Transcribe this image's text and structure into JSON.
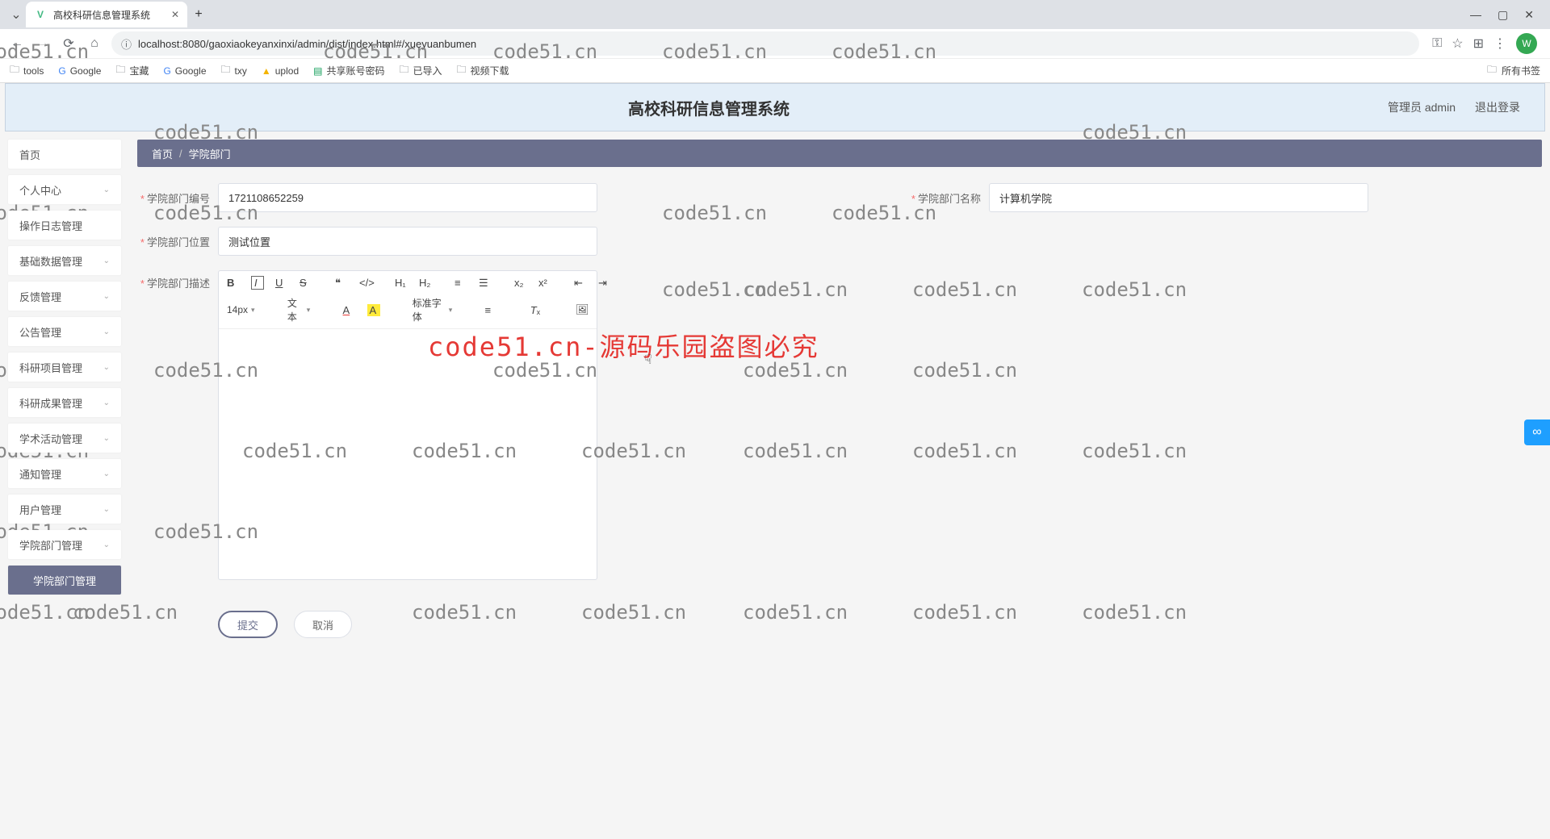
{
  "browser": {
    "tab_title": "高校科研信息管理系统",
    "url": "localhost:8080/gaoxiaokeyanxinxi/admin/dist/index.html#/xueyuanbumen",
    "avatar_letter": "W",
    "bookmarks": [
      "tools",
      "Google",
      "宝藏",
      "Google",
      "txy",
      "uplod",
      "共享账号密码",
      "已导入",
      "视频下载"
    ],
    "all_bookmarks": "所有书签"
  },
  "app": {
    "title": "高校科研信息管理系统",
    "user_label": "管理员 admin",
    "logout": "退出登录"
  },
  "sidebar": {
    "items": [
      {
        "label": "首页",
        "expandable": false
      },
      {
        "label": "个人中心",
        "expandable": true
      },
      {
        "label": "操作日志管理",
        "expandable": false
      },
      {
        "label": "基础数据管理",
        "expandable": true
      },
      {
        "label": "反馈管理",
        "expandable": true
      },
      {
        "label": "公告管理",
        "expandable": true
      },
      {
        "label": "科研项目管理",
        "expandable": true
      },
      {
        "label": "科研成果管理",
        "expandable": true
      },
      {
        "label": "学术活动管理",
        "expandable": true
      },
      {
        "label": "通知管理",
        "expandable": true
      },
      {
        "label": "用户管理",
        "expandable": true
      },
      {
        "label": "学院部门管理",
        "expandable": true
      }
    ],
    "active_sub": "学院部门管理"
  },
  "breadcrumb": {
    "home": "首页",
    "current": "学院部门"
  },
  "form": {
    "dept_no_label": "学院部门编号",
    "dept_no_value": "1721108652259",
    "dept_name_label": "学院部门名称",
    "dept_name_value": "计算机学院",
    "dept_loc_label": "学院部门位置",
    "dept_loc_value": "测试位置",
    "dept_desc_label": "学院部门描述",
    "submit": "提交",
    "cancel": "取消"
  },
  "editor": {
    "font_size": "14px",
    "text_label": "文本",
    "font_family": "标准字体"
  },
  "watermark": {
    "text": "code51.cn",
    "big": "code51.cn-源码乐园盗图必究"
  }
}
